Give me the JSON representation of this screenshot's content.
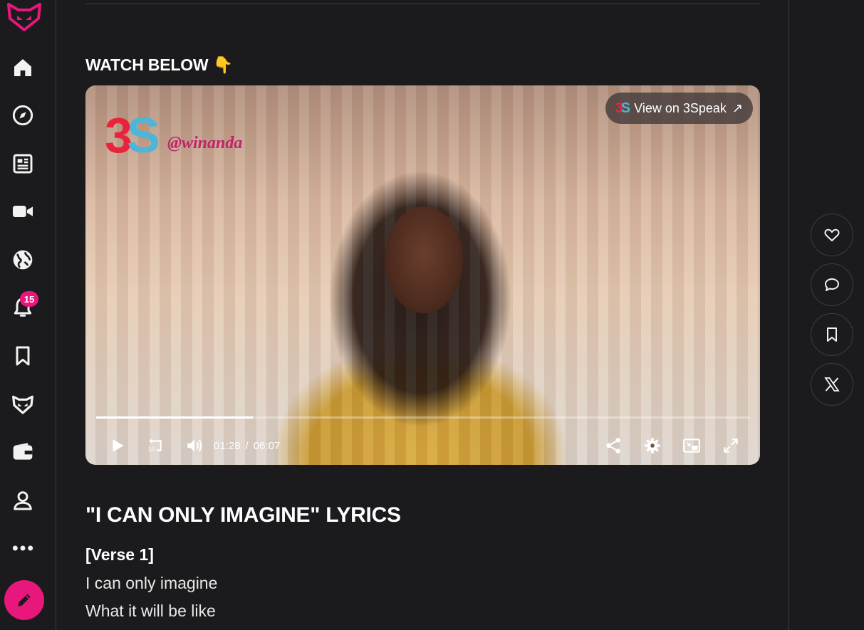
{
  "sidebar": {
    "notification_count": "15",
    "items": [
      {
        "name": "brand-logo",
        "icon": "fox-logo-icon"
      },
      {
        "name": "home",
        "icon": "home-icon"
      },
      {
        "name": "explore",
        "icon": "compass-icon"
      },
      {
        "name": "news",
        "icon": "newspaper-icon"
      },
      {
        "name": "videos",
        "icon": "video-camera-icon"
      },
      {
        "name": "communities",
        "icon": "globe-icon"
      },
      {
        "name": "notifications",
        "icon": "bell-icon"
      },
      {
        "name": "bookmarks",
        "icon": "bookmark-icon"
      },
      {
        "name": "fox-hub",
        "icon": "fox-icon"
      },
      {
        "name": "wallet",
        "icon": "wallet-icon"
      },
      {
        "name": "profile",
        "icon": "user-icon"
      },
      {
        "name": "more",
        "icon": "more-dots-icon"
      }
    ],
    "compose_icon": "pencil-icon",
    "brand_color": "#e8177b"
  },
  "post": {
    "watch_heading": "WATCH BELOW 👇",
    "video": {
      "logo_text_3": "3",
      "logo_text_s": "S",
      "handle": "@winanda",
      "view_on_label": "View on 3Speak",
      "view_on_arrow": "↗",
      "view_on_logo": "3S",
      "current_time": "01:28",
      "separator": "/",
      "duration": "06:07",
      "progress": 0.24,
      "skip_back_seconds": "10"
    },
    "lyrics_heading": "\"I CAN ONLY IMAGINE\" LYRICS",
    "verse_label": "[Verse 1]",
    "lines": [
      "I can only imagine",
      "What it will be like"
    ]
  },
  "actions": [
    {
      "name": "like",
      "icon": "heart-icon"
    },
    {
      "name": "comment",
      "icon": "comment-icon"
    },
    {
      "name": "bookmark",
      "icon": "bookmark-icon"
    },
    {
      "name": "share-x",
      "icon": "x-logo-icon"
    }
  ]
}
